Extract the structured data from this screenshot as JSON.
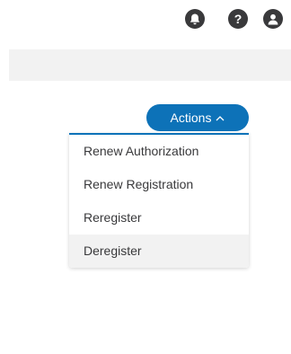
{
  "header": {
    "icons": [
      {
        "name": "notification-bell-icon"
      },
      {
        "name": "help-icon",
        "glyph": "?"
      },
      {
        "name": "user-profile-icon"
      }
    ]
  },
  "actions": {
    "label": "Actions",
    "accent_color": "#0d72b8",
    "expanded": true,
    "menu_items": [
      {
        "label": "Renew Authorization"
      },
      {
        "label": "Renew Registration"
      },
      {
        "label": "Reregister"
      },
      {
        "label": "Deregister",
        "hovered": true
      }
    ]
  }
}
